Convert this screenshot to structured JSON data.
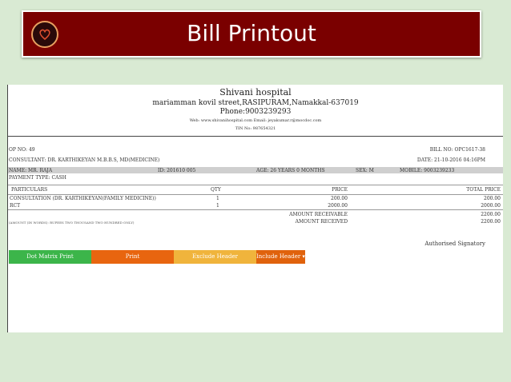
{
  "banner": {
    "title": "Bill Printout"
  },
  "hospital": {
    "name": "Shivani hospital",
    "address": "mariamman kovil street,RASIPURAM,Namakkal-637019",
    "phone": "Phone:9003239293",
    "web": "Web: www.shivanihospital.com  Email: jeyakumar.r@mocdoc.com",
    "tin": "TIN No: 987654321"
  },
  "bill": {
    "op_no": "OP NO: 49",
    "bill_no": "BILL NO: OPC1617-38",
    "consultant": "CONSULTANT: DR. KARTHIKEYAN M.B.B.S, MD(MEDICINE)",
    "date": "DATE: 21-10-2016 04:16PM",
    "patient": {
      "name": "NAME: MR. RAJA",
      "id": "ID: 201610 005",
      "age": "AGE: 26 YEARS 0 MONTHS",
      "sex": "SEX: M",
      "mobile": "MOBILE: 9003239233"
    },
    "payment_type": "PAYMENT TYPE: CASH",
    "table": {
      "headers": [
        "PARTICULARS",
        "QTY",
        "PRICE",
        "TOTAL PRICE"
      ],
      "rows": [
        [
          "CONSULTATION (DR. KARTHIKEYAN(FAMILY MEDICINE))",
          "1",
          "200.00",
          "200.00"
        ],
        [
          "RCT",
          "1",
          "2000.00",
          "2000.00"
        ]
      ]
    },
    "amount_receivable_label": "AMOUNT RECEIVABLE",
    "amount_receivable": "2200.00",
    "amount_in_words": "(AMOUNT (IN WORDS): RUPEES TWO THOUSAND TWO HUNDRED ONLY)",
    "amount_received_label": "AMOUNT RECEIVED",
    "amount_received": "2200.00",
    "signatory": "Authorised Signatory"
  },
  "actions": {
    "dot_matrix": "Dot Matrix Print",
    "print": "Print",
    "exclude_header": "Exclude Header",
    "include_header": "Include Header ▾"
  },
  "colors": {
    "banner": "#7a0000",
    "dot_matrix": "#3cb54a",
    "print": "#e8650f",
    "exclude_header": "#f0b43c",
    "include_header": "#e0620c"
  }
}
